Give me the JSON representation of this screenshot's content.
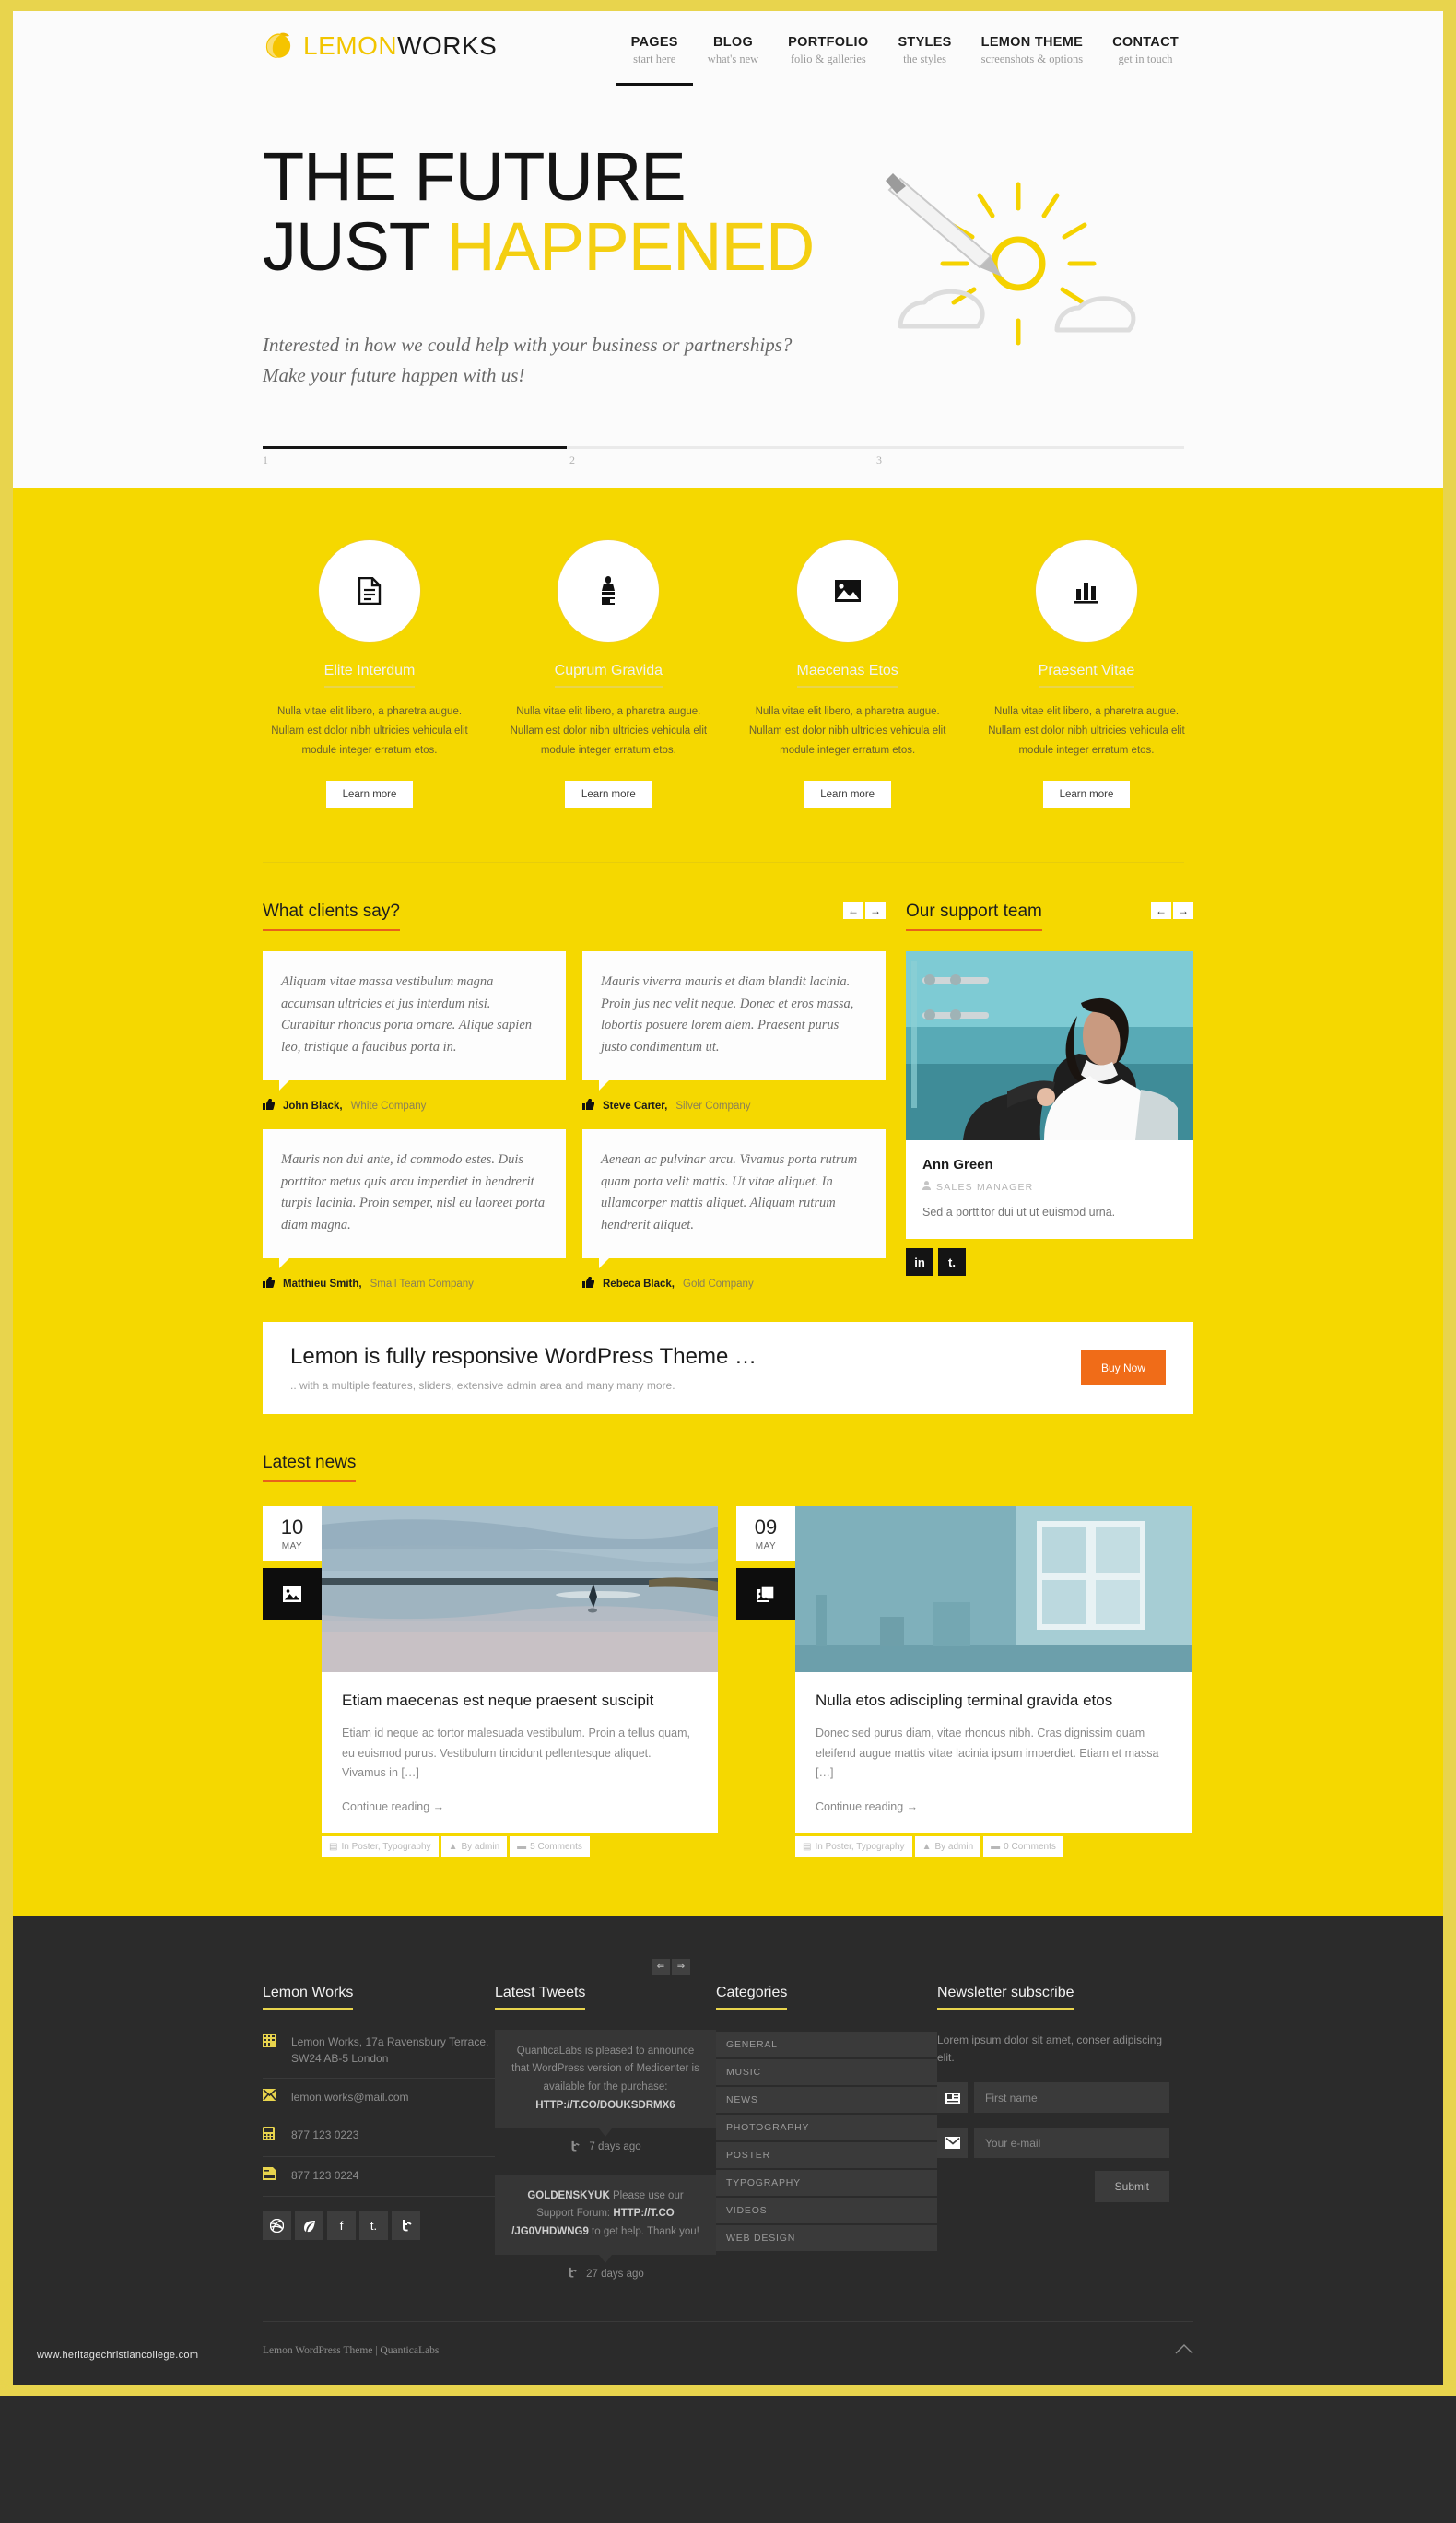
{
  "brand": {
    "name_a": "LEMON",
    "name_b": "WORKS",
    "logo_icon": "lemon-icon"
  },
  "nav": [
    {
      "title": "PAGES",
      "sub": "start here",
      "active": true
    },
    {
      "title": "BLOG",
      "sub": "what's new",
      "active": false
    },
    {
      "title": "PORTFOLIO",
      "sub": "folio & galleries",
      "active": false
    },
    {
      "title": "STYLES",
      "sub": "the styles",
      "active": false
    },
    {
      "title": "LEMON THEME",
      "sub": "screenshots & options",
      "active": false
    },
    {
      "title": "CONTACT",
      "sub": "get in touch",
      "active": false
    }
  ],
  "hero": {
    "line1": "THE FUTURE",
    "line2_plain": "JUST ",
    "line2_hl": "HAPPENED",
    "sub1": "Interested in how we could help with your business or partnerships?",
    "sub2": "Make your future happen with us!",
    "slides": [
      "1",
      "2",
      "3"
    ],
    "active_slide": 1,
    "art_icon": "sun-clouds-pencil-illustration"
  },
  "features": [
    {
      "icon": "document-icon",
      "title": "Elite Interdum",
      "desc": "Nulla vitae elit libero, a pharetra augue. Nullam est dolor nibh ultricies vehicula elit module integer erratum etos.",
      "button": "Learn more"
    },
    {
      "icon": "paintbrush-icon",
      "title": "Cuprum Gravida",
      "desc": "Nulla vitae elit libero, a pharetra augue. Nullam est dolor nibh ultricies vehicula elit module integer erratum etos.",
      "button": "Learn more"
    },
    {
      "icon": "image-icon",
      "title": "Maecenas Etos",
      "desc": "Nulla vitae elit libero, a pharetra augue. Nullam est dolor nibh ultricies vehicula elit module integer erratum etos.",
      "button": "Learn more"
    },
    {
      "icon": "bar-chart-icon",
      "title": "Praesent Vitae",
      "desc": "Nulla vitae elit libero, a pharetra augue. Nullam est dolor nibh ultricies vehicula elit module integer erratum etos.",
      "button": "Learn more"
    }
  ],
  "testimonials": {
    "title": "What clients say?",
    "prev": "←",
    "next": "→",
    "items": [
      {
        "quote": "Aliquam vitae massa vestibulum magna accumsan ultricies et jus interdum nisi. Curabitur rhoncus porta ornare. Alique sapien leo, tristique a faucibus porta in.",
        "name": "John Black,",
        "company": "White Company"
      },
      {
        "quote": "Mauris viverra mauris et diam blandit lacinia. Proin jus nec velit neque. Donec et eros massa, lobortis posuere lorem alem. Praesent purus justo condimentum ut.",
        "name": "Steve Carter,",
        "company": "Silver Company"
      },
      {
        "quote": "Mauris non dui ante, id commodo estes. Duis porttitor metus quis arcu imperdiet in hendrerit turpis lacinia. Proin semper, nisl eu laoreet porta diam magna.",
        "name": "Matthieu Smith,",
        "company": "Small Team Company"
      },
      {
        "quote": "Aenean ac pulvinar arcu. Vivamus porta rutrum quam porta velit mattis. Ut vitae aliquet. In ullamcorper mattis aliquet. Aliquam rutrum hendrerit aliquet.",
        "name": "Rebeca Black,",
        "company": "Gold Company"
      }
    ]
  },
  "team": {
    "title": "Our support team",
    "prev": "←",
    "next": "→",
    "member": {
      "name": "Ann Green",
      "role": "SALES MANAGER",
      "text": "Sed a porttitor dui ut ut euismod urna.",
      "photo_alt": "businesswoman-portrait",
      "social": [
        {
          "icon": "linkedin-icon",
          "label": "in"
        },
        {
          "icon": "tumblr-icon",
          "label": "t."
        }
      ]
    }
  },
  "cta": {
    "heading": "Lemon is fully responsive WordPress Theme …",
    "sub": ".. with a multiple features, sliders, extensive admin area and many many more.",
    "button": "Buy Now",
    "button_color": "#f06c18"
  },
  "news": {
    "title": "Latest news",
    "posts": [
      {
        "day": "10",
        "month": "MAY",
        "format_icon": "image-icon",
        "image_alt": "beach-seascape-photo",
        "title": "Etiam maecenas est neque praesent suscipit",
        "excerpt": "Etiam id neque ac tortor malesuada vestibulum. Proin a tellus quam, eu euismod purus. Vestibulum tincidunt pellentesque aliquet. Vivamus in […]",
        "more": "Continue reading →",
        "meta": [
          {
            "icon": "folder-icon",
            "label": "In Poster, Typography"
          },
          {
            "icon": "user-icon",
            "label": "By admin"
          },
          {
            "icon": "comment-icon",
            "label": "5 Comments"
          }
        ]
      },
      {
        "day": "09",
        "month": "MAY",
        "format_icon": "gallery-icon",
        "image_alt": "blue-room-window-photo",
        "title": "Nulla etos adiscipling terminal gravida etos",
        "excerpt": "Donec sed purus diam, vitae rhoncus nibh. Cras dignissim quam eleifend augue mattis vitae lacinia ipsum imperdiet. Etiam et massa […]",
        "more": "Continue reading →",
        "meta": [
          {
            "icon": "folder-icon",
            "label": "In Poster, Typography"
          },
          {
            "icon": "user-icon",
            "label": "By admin"
          },
          {
            "icon": "comment-icon",
            "label": "0 Comments"
          }
        ]
      }
    ]
  },
  "footer": {
    "about": {
      "title": "Lemon Works",
      "contacts": [
        {
          "icon": "building-icon",
          "text": "Lemon Works, 17a Ravensbury Terrace, SW24 AB-5 London"
        },
        {
          "icon": "envelope-icon",
          "text": "lemon.works@mail.com"
        },
        {
          "icon": "phone-icon",
          "text": "877 123 0223"
        },
        {
          "icon": "fax-icon",
          "text": "877 123 0224"
        }
      ],
      "social": [
        {
          "icon": "dribbble-icon",
          "label": "ⓓ"
        },
        {
          "icon": "leaf-icon",
          "label": "◗"
        },
        {
          "icon": "facebook-icon",
          "label": "f"
        },
        {
          "icon": "tumblr-icon",
          "label": "t."
        },
        {
          "icon": "twitter-icon",
          "label": "ŧ"
        }
      ]
    },
    "tweets": {
      "title": "Latest Tweets",
      "prev": "⇐",
      "next": "⇒",
      "items": [
        {
          "pre": "",
          "text": "QuanticaLabs is pleased to announce that WordPress version of Medicenter is available for the purchase: ",
          "link": "HTTP://T.CO/DOUKSDRMX6",
          "post": "",
          "time": "7 days ago"
        },
        {
          "pre": "GOLDENSKYUK",
          "text": " Please use our Support Forum: ",
          "link": "HTTP://T.CO /JG0VHDWNG9",
          "post": " to get help. Thank you!",
          "time": "27 days ago"
        }
      ]
    },
    "categories": {
      "title": "Categories",
      "items": [
        "GENERAL",
        "MUSIC",
        "NEWS",
        "PHOTOGRAPHY",
        "POSTER",
        "TYPOGRAPHY",
        "VIDEOS",
        "WEB DESIGN"
      ]
    },
    "newsletter": {
      "title": "Newsletter subscribe",
      "text": "Lorem ipsum dolor sit amet, conser adipiscing elit.",
      "name_placeholder": "First name",
      "name_value": "",
      "email_placeholder": "Your e-mail",
      "email_value": "",
      "name_icon": "contact-card-icon",
      "email_icon": "envelope-icon",
      "submit": "Submit"
    },
    "copyright": "Lemon WordPress Theme  |  QuanticaLabs",
    "to_top_icon": "chevron-up-icon",
    "watermark": "www.heritagechristiancollege.com"
  }
}
